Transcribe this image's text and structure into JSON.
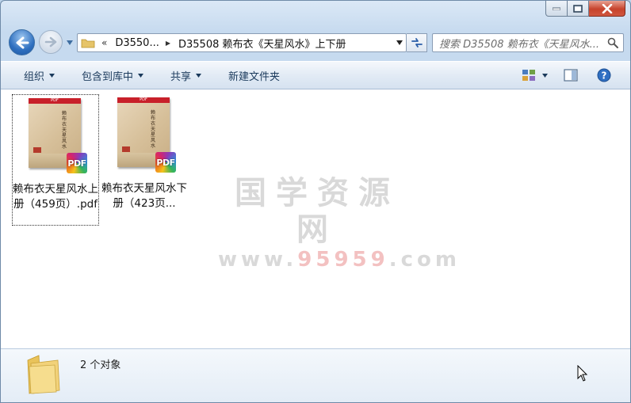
{
  "window": {
    "title": ""
  },
  "nav": {
    "chevron": "«",
    "crumbs": [
      "D3550...",
      "D35508 赖布衣《天星风水》上下册"
    ],
    "search_placeholder": "搜索 D35508 赖布衣《天星风水..."
  },
  "toolbar": {
    "organize": "组织",
    "include_library": "包含到库中",
    "share": "共享",
    "new_folder": "新建文件夹"
  },
  "files": [
    {
      "name": "赖布衣天星风水上册（459页）.pdf",
      "badge": "PDF",
      "band": "PDF",
      "cover_title": "赖布衣天星风水",
      "selected": true
    },
    {
      "name": "赖布衣天星风水下册（423页...",
      "badge": "PDF",
      "band": "PDF",
      "cover_title": "赖布衣天星风水",
      "selected": false
    }
  ],
  "watermark": {
    "line1": "国学资源网",
    "line2_a": "www.",
    "line2_b": "95959",
    "line2_c": ".com"
  },
  "details": {
    "count_text": "2 个对象"
  },
  "colors": {
    "accent": "#2e6fbf",
    "close": "#c7432c",
    "toolbar_text": "#1b3a5c"
  }
}
